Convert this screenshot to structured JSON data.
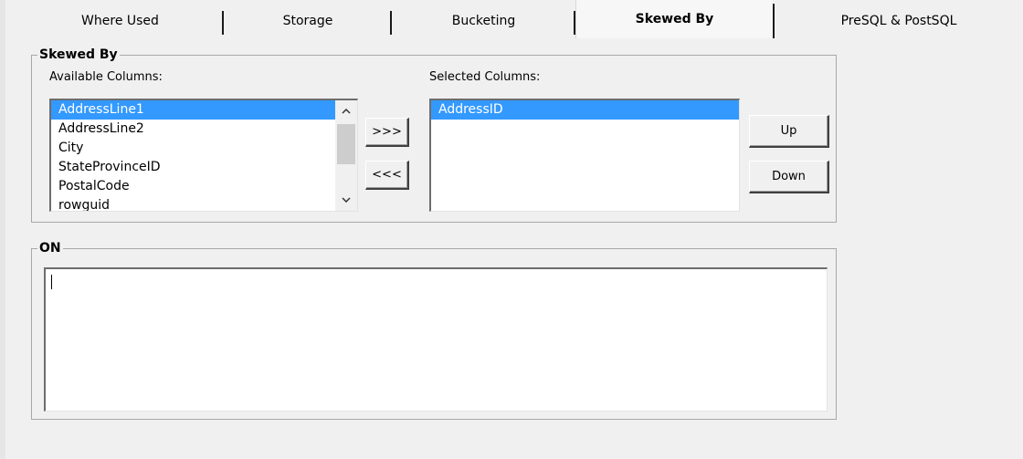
{
  "tabs": [
    {
      "label": "Where Used",
      "active": false
    },
    {
      "label": "Storage",
      "active": false
    },
    {
      "label": "Bucketing",
      "active": false
    },
    {
      "label": "Skewed By",
      "active": true
    },
    {
      "label": "PreSQL & PostSQL",
      "active": false
    }
  ],
  "skewed_group": {
    "title": "Skewed By",
    "available_label": "Available Columns:",
    "selected_label": "Selected Columns:",
    "available_columns": [
      "AddressLine1",
      "AddressLine2",
      "City",
      "StateProvinceID",
      "PostalCode",
      "rowguid"
    ],
    "available_selected": "AddressLine1",
    "selected_columns": [
      "AddressID"
    ],
    "add_button": ">>>",
    "remove_button": "<<<",
    "up_button": "Up",
    "down_button": "Down"
  },
  "on_group": {
    "title": "ON",
    "text": ""
  },
  "colors": {
    "selection": "#3399ff",
    "background": "#f0f0f0"
  }
}
